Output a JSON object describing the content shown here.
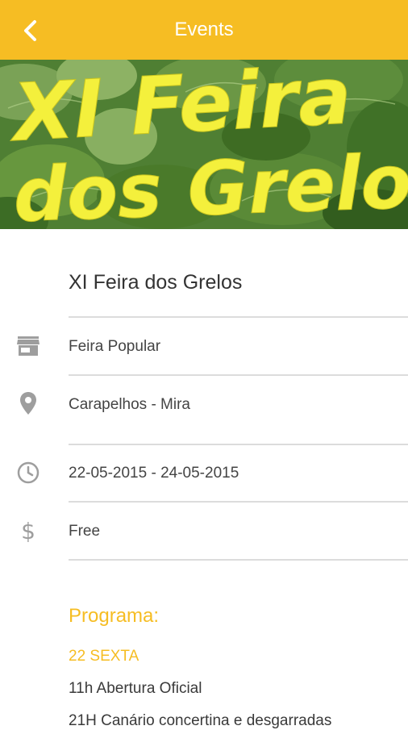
{
  "appbar": {
    "title": "Events",
    "back_icon": "chevron-left-icon",
    "color": "#f6bd23"
  },
  "banner": {
    "line1": "XI Feira",
    "line2": "dos Grelos",
    "text_color": "#f4f03c"
  },
  "event": {
    "title": "XI Feira dos Grelos",
    "details": [
      {
        "icon": "store-icon",
        "text": "Feira Popular"
      },
      {
        "icon": "location-pin-icon",
        "text": "Carapelhos - Mira"
      },
      {
        "icon": "clock-icon",
        "text": "22-05-2015 - 24-05-2015"
      },
      {
        "icon": "dollar-icon",
        "text": "Free"
      }
    ]
  },
  "program": {
    "heading": "Programa:",
    "day": "22 SEXTA",
    "items": [
      "11h Abertura Oficial",
      "21H Canário concertina e desgarradas"
    ]
  }
}
